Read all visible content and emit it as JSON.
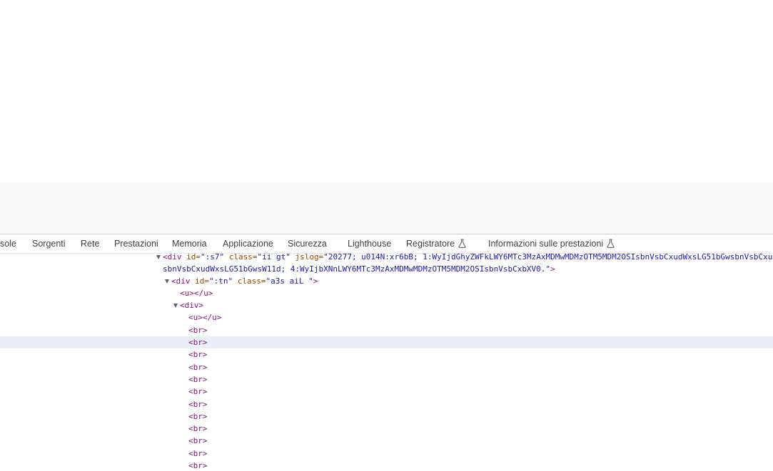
{
  "devtools": {
    "tabs": [
      {
        "label": "sole",
        "experimental": false
      },
      {
        "label": "Sorgenti",
        "experimental": false
      },
      {
        "label": "Rete",
        "experimental": false
      },
      {
        "label": "Prestazioni",
        "experimental": false
      },
      {
        "label": "Memoria",
        "experimental": false
      },
      {
        "label": "Applicazione",
        "experimental": false
      },
      {
        "label": "Sicurezza",
        "experimental": false
      },
      {
        "label": "Lighthouse",
        "experimental": false
      },
      {
        "label": "Registratore",
        "experimental": true
      },
      {
        "label": "Informazioni sulle prestazioni",
        "experimental": true
      }
    ],
    "flask_icon": "flask-icon"
  },
  "dom_tree": {
    "line1": {
      "open": "<div",
      "a1n": " id=",
      "a1v": "\":s7\"",
      "a2n": " class=",
      "a2v": "\"ii gt\"",
      "a3n": " jslog=",
      "a3v": "\"20277; u014N:xr6bB; 1:WyIjdGhyZWFkLWY6MTc3MzAxMDMwMDMzOTM5MDM2OSIsbnVsbCxudWxsLG51bGwsbnVsbCxud"
    },
    "line2": {
      "cont": "sbnVsbCxudWxsLG51bGwsW11d; 4:WyIjbXNnLWY6MTc3MzAxMDMwMDMzOTM5MDM2OSIsbnVsbCxbXV0.\"",
      "close": ">"
    },
    "line3": {
      "open": "<div",
      "a1n": " id=",
      "a1v": "\":tn\"",
      "a2n": " class=",
      "a2v": "\"a3s aiL \"",
      "close": ">"
    },
    "u_line": "<u></u>",
    "div_open": "<div>",
    "br": "<br>"
  },
  "colors": {
    "tag": "#881280",
    "attribute_name": "#994500",
    "attribute_value": "#1a1aa6",
    "selected_row": "#e9eff8"
  }
}
